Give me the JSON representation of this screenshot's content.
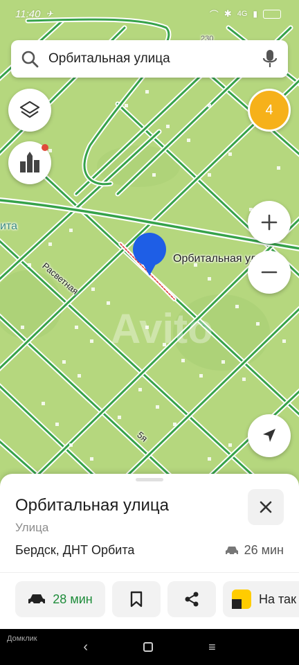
{
  "status": {
    "time": "11:40",
    "battery": "",
    "network": "4G"
  },
  "search": {
    "value": "Орбитальная улица"
  },
  "map": {
    "badge_count": "4",
    "label_number": "230",
    "label_left_edge": "ита",
    "street_rasvetnaya": "Расветная",
    "street_5ya": "5я",
    "pin_label": "Орбитальная улица",
    "watermark": "Avito",
    "colors": {
      "land": "#b5d77e",
      "road": "#36a24a",
      "pin": "#1e5ee6",
      "badge": "#f6b11a"
    }
  },
  "sheet": {
    "title": "Орбитальная улица",
    "subtitle": "Улица",
    "address": "Бердск, ДНТ Орбита",
    "eta_car": "26 мин",
    "route_button": "28 мин",
    "taxi_button": "На так"
  },
  "navbar": {
    "watermark": "Домклик"
  },
  "icons": [
    "search-icon",
    "mic-icon",
    "layers-icon",
    "landmarks-icon",
    "plus-icon",
    "minus-icon",
    "locate-icon",
    "close-icon",
    "car-icon",
    "bookmark-icon",
    "share-icon",
    "taxi-icon"
  ]
}
